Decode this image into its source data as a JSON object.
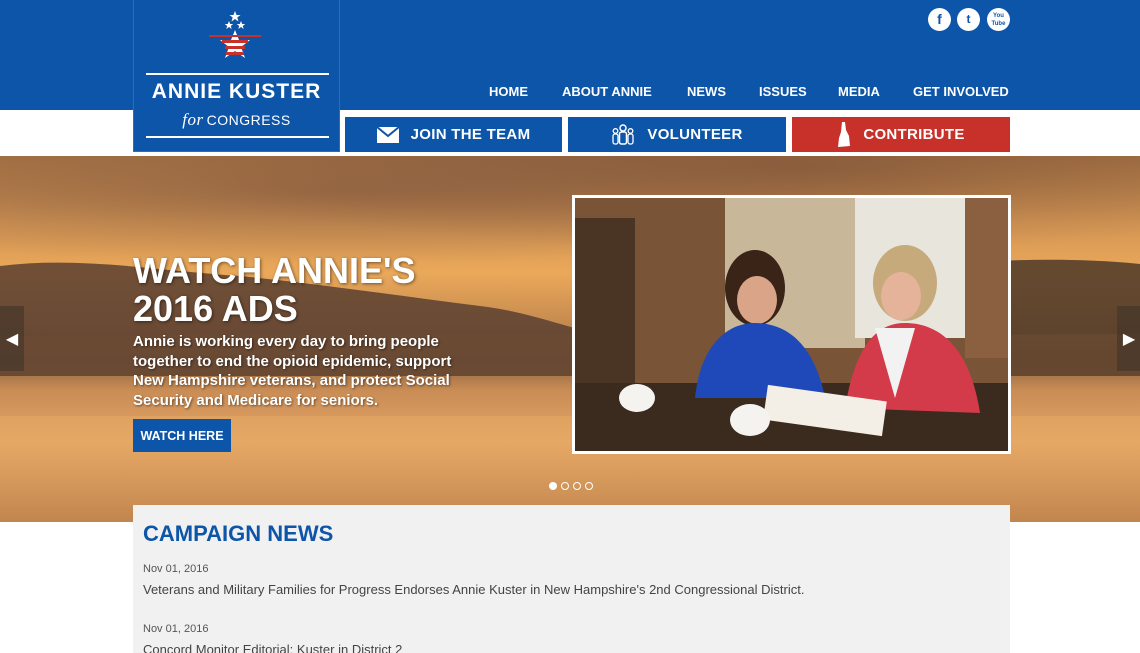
{
  "logo": {
    "name": "ANNIE KUSTER",
    "for": "for",
    "congress": "CONGRESS"
  },
  "social": [
    {
      "icon": "facebook-icon",
      "glyph": "f"
    },
    {
      "icon": "twitter-icon",
      "glyph": "t"
    },
    {
      "icon": "youtube-icon",
      "glyph": "You Tube"
    }
  ],
  "nav": [
    {
      "label": "HOME"
    },
    {
      "label": "ABOUT ANNIE"
    },
    {
      "label": "NEWS"
    },
    {
      "label": "ISSUES"
    },
    {
      "label": "MEDIA"
    },
    {
      "label": "GET INVOLVED"
    }
  ],
  "actions": [
    {
      "label": "JOIN THE TEAM",
      "icon": "envelope-icon",
      "color": "#0d55a8"
    },
    {
      "label": "VOLUNTEER",
      "icon": "people-icon",
      "color": "#0d55a8"
    },
    {
      "label": "CONTRIBUTE",
      "icon": "new-hampshire-icon",
      "color": "#c8302a"
    }
  ],
  "hero": {
    "title_line1": "WATCH ANNIE'S",
    "title_line2": "2016 ADS",
    "text": "Annie is working every day to bring people together to end the opioid epidemic, support New Hampshire veterans, and protect Social Security and Medicare for seniors.",
    "button": "WATCH HERE",
    "slides": 4,
    "active_slide": 1
  },
  "news": {
    "title": "CAMPAIGN NEWS",
    "items": [
      {
        "date": "Nov 01, 2016",
        "headline": "Veterans and Military Families for Progress Endorses Annie Kuster in New Hampshire's 2nd Congressional District."
      },
      {
        "date": "Nov 01, 2016",
        "headline": "Concord Monitor Editorial: Kuster in District 2"
      }
    ]
  },
  "colors": {
    "brand_blue": "#0d55a8",
    "contribute_red": "#c8302a",
    "news_bg": "#f1f1f1"
  }
}
